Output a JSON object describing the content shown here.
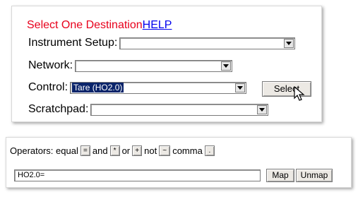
{
  "destination": {
    "title": "Select One Destination",
    "help": "HELP",
    "instrument_setup_label": "Instrument Setup:",
    "instrument_setup_value": "",
    "network_label": "Network:",
    "network_value": "",
    "control_label": "Control:",
    "control_value": "Tare (HO2.0)",
    "select_button": "Select",
    "scratchpad_label": "Scratchpad:",
    "scratchpad_value": ""
  },
  "operators": {
    "label": "Operators:",
    "equal_label": "equal",
    "equal_symbol": "=",
    "and_label": "and",
    "and_symbol": "*",
    "or_label": "or",
    "or_symbol": "+",
    "not_label": "not",
    "not_symbol": "~",
    "comma_label": "comma",
    "comma_symbol": ".",
    "expression_value": "HO2.0=",
    "map_button": "Map",
    "unmap_button": "Unmap"
  },
  "colors": {
    "title": "#e8001c",
    "link": "#0000ee",
    "selection": "#0a246a"
  },
  "icons": {
    "dropdown": "chevron-down-icon",
    "cursor": "mouse-pointer-icon"
  }
}
